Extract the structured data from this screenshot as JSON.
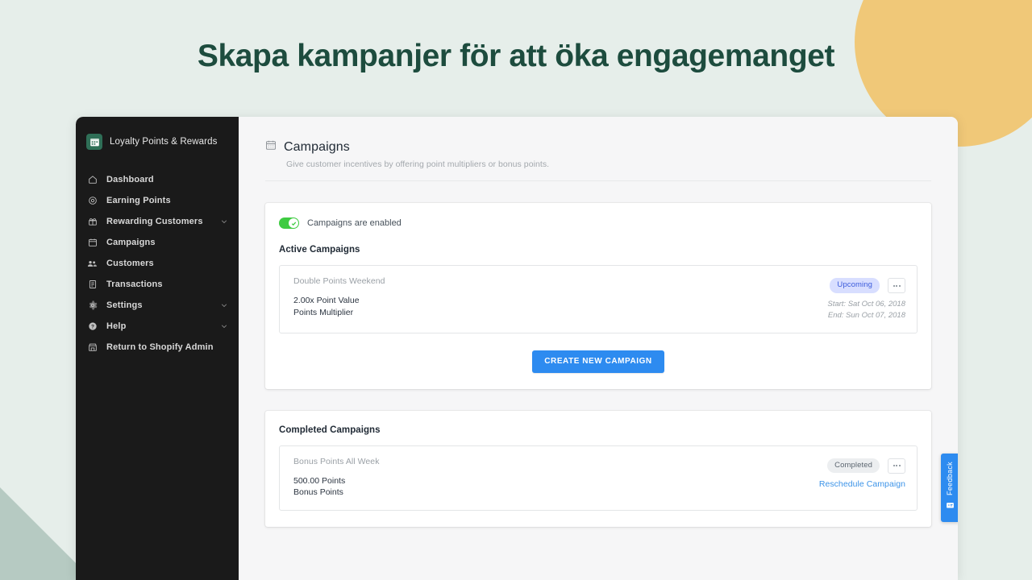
{
  "headline": "Skapa kampanjer för att öka engagemanget",
  "theme": {
    "background": "#e6eeea",
    "headline_color": "#1d4c3e",
    "accent_blue": "#2d8bf0",
    "toggle_green": "#3ecb41",
    "circle_color": "#f0c878",
    "triangle_color": "#b6cac2",
    "sidebar_bg": "#1a1a1a"
  },
  "sidebar": {
    "brand": "Loyalty Points & Rewards",
    "brand_icon": "calendar-app-logo-icon",
    "items": [
      {
        "label": "Dashboard",
        "icon": "home-icon",
        "chevron": false
      },
      {
        "label": "Earning Points",
        "icon": "target-icon",
        "chevron": false
      },
      {
        "label": "Rewarding Customers",
        "icon": "gift-icon",
        "chevron": true
      },
      {
        "label": "Campaigns",
        "icon": "calendar-icon",
        "chevron": false
      },
      {
        "label": "Customers",
        "icon": "people-icon",
        "chevron": false
      },
      {
        "label": "Transactions",
        "icon": "receipt-icon",
        "chevron": false
      },
      {
        "label": "Settings",
        "icon": "gear-icon",
        "chevron": true
      },
      {
        "label": "Help",
        "icon": "help-circle-icon",
        "chevron": true
      },
      {
        "label": "Return to Shopify Admin",
        "icon": "store-icon",
        "chevron": false
      }
    ]
  },
  "main": {
    "title": "Campaigns",
    "title_icon": "calendar-icon",
    "subtitle": "Give customer incentives by offering point multipliers or bonus points.",
    "toggle": {
      "label": "Campaigns are enabled",
      "enabled": true
    },
    "active_section": {
      "title": "Active Campaigns",
      "campaigns": [
        {
          "name": "Double Points Weekend",
          "value": "2.00x Point Value",
          "type": "Points Multiplier",
          "badge": "Upcoming",
          "badge_style": "upcoming",
          "start": "Start: Sat Oct 06, 2018",
          "end": "End: Sun Oct 07, 2018",
          "link": ""
        }
      ],
      "cta": "CREATE NEW CAMPAIGN"
    },
    "completed_section": {
      "title": "Completed Campaigns",
      "campaigns": [
        {
          "name": "Bonus Points All Week",
          "value": "500.00 Points",
          "type": "Bonus Points",
          "badge": "Completed",
          "badge_style": "completed",
          "start": "",
          "end": "",
          "link": "Reschedule Campaign"
        }
      ]
    }
  },
  "feedback": {
    "label": "Feedback",
    "icon": "feedback-chat-icon"
  }
}
